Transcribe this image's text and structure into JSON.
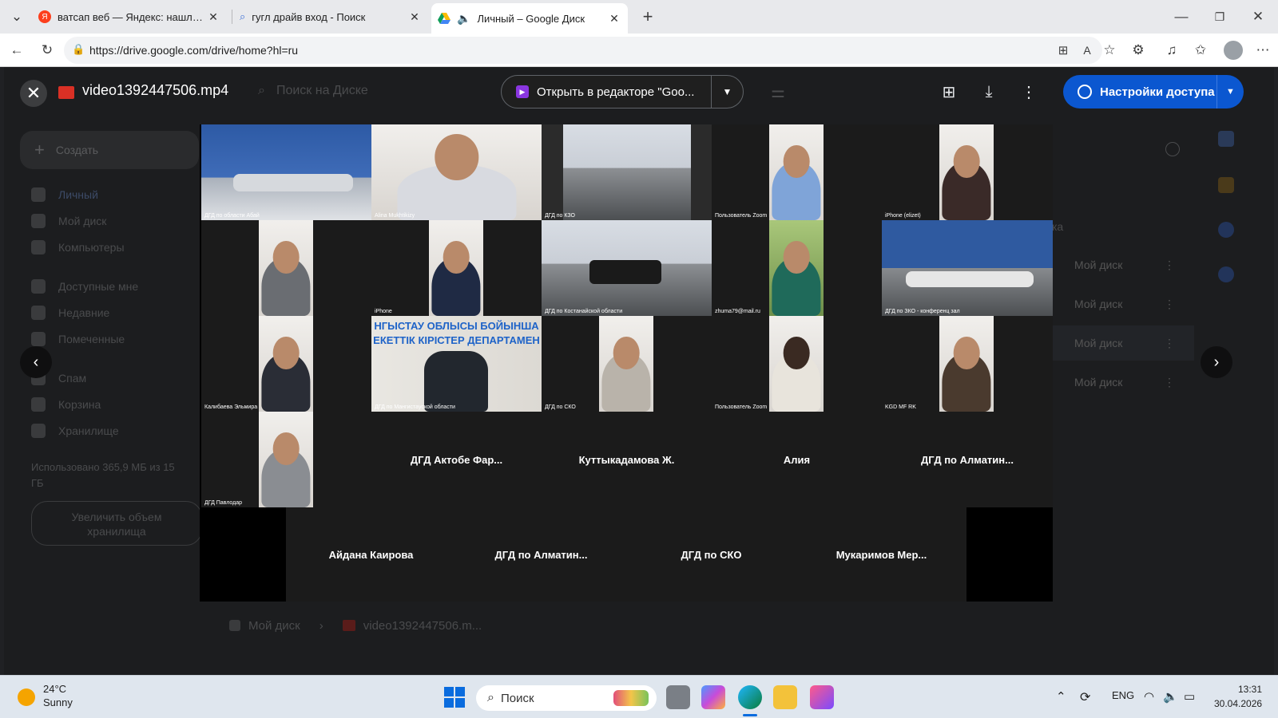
{
  "browser": {
    "tabs": [
      {
        "title": "ватсап веб — Яндекс: нашлось 4...",
        "icon": "yandex-icon"
      },
      {
        "title": "гугл драйв вход - Поиск",
        "icon": "search-icon"
      },
      {
        "title": "Личный – Google Диск",
        "icon": "google-drive-icon",
        "active": true
      }
    ],
    "url": "https://drive.google.com/drive/home?hl=ru"
  },
  "drive_background": {
    "create_label": "Создать",
    "sidebar": [
      "Личный",
      "Мой диск",
      "Компьютеры",
      "Доступные мне",
      "Недавние",
      "Помеченные",
      "Спам",
      "Корзина",
      "Хранилище"
    ],
    "storage_text": "Использовано 365,9 МБ из 15 ГБ",
    "upgrade_label": "Увеличить объем хранилища",
    "right_rows": [
      "Мой диск",
      "Мой диск",
      "Мой диск",
      "Мой диск"
    ],
    "right_header": "ка",
    "breadcrumb": [
      "Мой диск",
      "video1392447506.m..."
    ]
  },
  "viewer": {
    "file_name": "video1392447506.mp4",
    "search_placeholder": "Поиск на Диске",
    "open_with_label": "Открыть в редакторе \"Goo...",
    "share_label": "Настройки доступа",
    "accent": "#0b57d0"
  },
  "video_tiles": {
    "r1": [
      "ДГД по области Абай",
      "Alina Mukhtikizy",
      "ДГД по КЗО",
      "Пользователь Zoom",
      "iPhone (elizet)"
    ],
    "r2": [
      "iPhone",
      "ДГД по Костанайской области",
      "zhuma79@mail.ru",
      "ДГД по ЗКО - конференц зал"
    ],
    "r3": [
      "Калибаева Эльмира",
      "ДГД по Мангистауской области",
      "ДГД по СКО",
      "Пользователь Zoom",
      "KGD MF RK"
    ],
    "banner_line1": "НГЫСТАУ ОБЛЫСЫ БОЙЫНША",
    "banner_line2": "ЕКЕТТІК КІРІСТЕР ДЕПАРТАМЕН",
    "r4_label": "ДГД Павлодар",
    "r4_names": [
      "ДГД Актобе Фар...",
      "Куттыкадамова Ж.",
      "Алия",
      "ДГД по Алматин..."
    ],
    "r5_names": [
      "Айдана Каирова",
      "ДГД по Алматин...",
      "ДГД по СКО",
      "Мукаримов Мер..."
    ]
  },
  "taskbar": {
    "temperature": "24°C",
    "weather": "Sunny",
    "search_placeholder": "Поиск",
    "language": "ENG",
    "time": "13:31",
    "date": "30.04.2026"
  }
}
